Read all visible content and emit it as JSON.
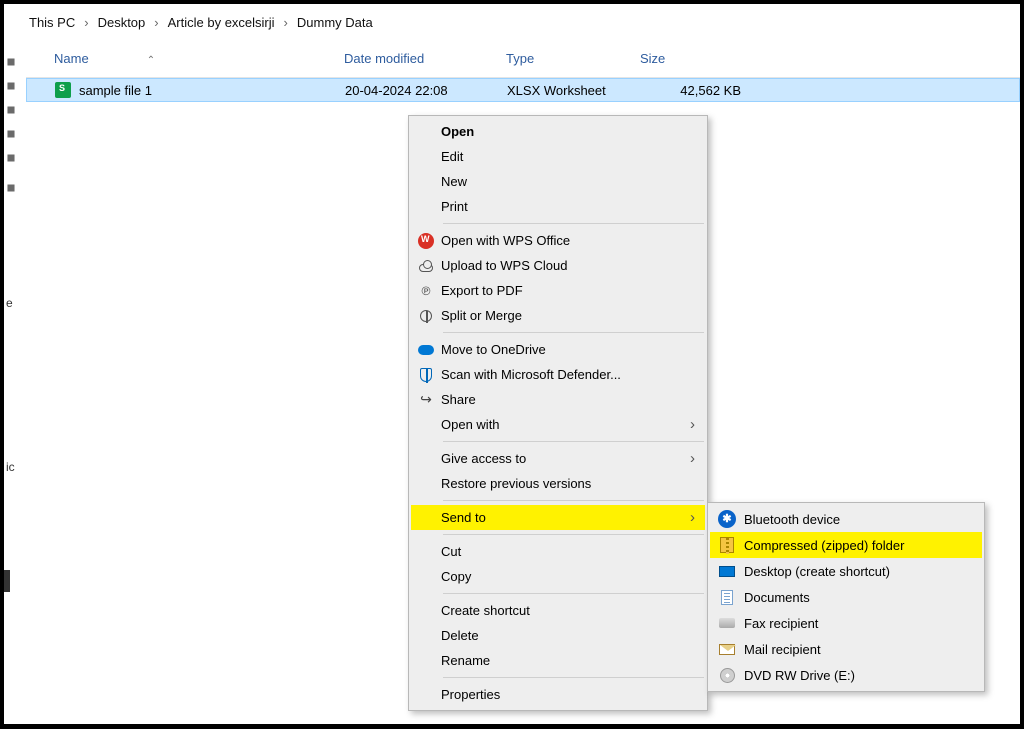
{
  "breadcrumb": {
    "items": [
      "This PC",
      "Desktop",
      "Article by excelsirji",
      "Dummy Data"
    ]
  },
  "columns": {
    "name": "Name",
    "date": "Date modified",
    "type": "Type",
    "size": "Size"
  },
  "file": {
    "name": "sample file 1",
    "date": "20-04-2024 22:08",
    "type": "XLSX Worksheet",
    "size": "42,562 KB"
  },
  "context_menu": {
    "open": "Open",
    "edit": "Edit",
    "new": "New",
    "print": "Print",
    "open_wps": "Open with WPS Office",
    "upload_wps": "Upload to WPS Cloud",
    "export_pdf": "Export to PDF",
    "split_merge": "Split or Merge",
    "onedrive": "Move to OneDrive",
    "defender": "Scan with Microsoft Defender...",
    "share": "Share",
    "open_with": "Open with",
    "give_access": "Give access to",
    "restore": "Restore previous versions",
    "send_to": "Send to",
    "cut": "Cut",
    "copy": "Copy",
    "shortcut": "Create shortcut",
    "delete": "Delete",
    "rename": "Rename",
    "properties": "Properties"
  },
  "submenu": {
    "bluetooth": "Bluetooth device",
    "zipped": "Compressed (zipped) folder",
    "desktop": "Desktop (create shortcut)",
    "documents": "Documents",
    "fax": "Fax recipient",
    "mail": "Mail recipient",
    "dvd": "DVD RW Drive (E:)"
  },
  "sidebar_fragments": {
    "a": "e",
    "b": "ic"
  }
}
